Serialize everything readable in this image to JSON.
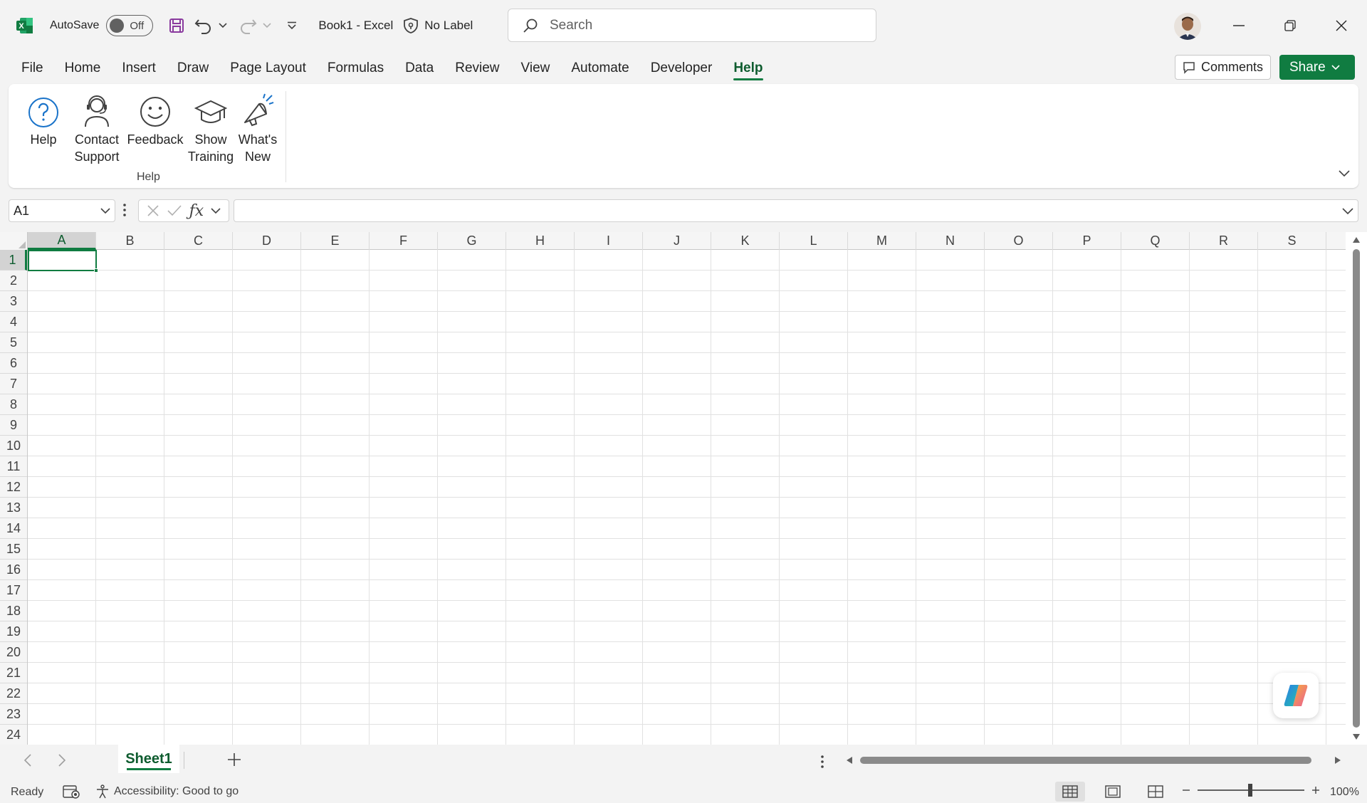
{
  "titlebar": {
    "autosave_label": "AutoSave",
    "autosave_state": "Off",
    "doc_title": "Book1  -  Excel",
    "sensitivity_label": "No Label",
    "search_placeholder": "Search"
  },
  "tabs": [
    "File",
    "Home",
    "Insert",
    "Draw",
    "Page Layout",
    "Formulas",
    "Data",
    "Review",
    "View",
    "Automate",
    "Developer",
    "Help"
  ],
  "active_tab": "Help",
  "header_actions": {
    "comments": "Comments",
    "share": "Share"
  },
  "ribbon": {
    "group_label": "Help",
    "buttons": [
      {
        "line1": "Help",
        "line2": ""
      },
      {
        "line1": "Contact",
        "line2": "Support"
      },
      {
        "line1": "Feedback",
        "line2": ""
      },
      {
        "line1": "Show",
        "line2": "Training"
      },
      {
        "line1": "What's",
        "line2": "New"
      }
    ]
  },
  "formula_bar": {
    "name_box": "A1",
    "formula": ""
  },
  "grid": {
    "columns": [
      "A",
      "B",
      "C",
      "D",
      "E",
      "F",
      "G",
      "H",
      "I",
      "J",
      "K",
      "L",
      "M",
      "N",
      "O",
      "P",
      "Q",
      "R",
      "S"
    ],
    "rows": [
      "1",
      "2",
      "3",
      "4",
      "5",
      "6",
      "7",
      "8",
      "9",
      "10",
      "11",
      "12",
      "13",
      "14",
      "15",
      "16",
      "17",
      "18",
      "19",
      "20",
      "21",
      "22",
      "23",
      "24"
    ],
    "selected_cell": "A1"
  },
  "sheets": {
    "tabs": [
      "Sheet1"
    ],
    "active": "Sheet1"
  },
  "status": {
    "ready": "Ready",
    "accessibility": "Accessibility: Good to go",
    "zoom": "100%"
  },
  "colors": {
    "accent": "#107c41",
    "accent_text": "#0e5c2f"
  }
}
